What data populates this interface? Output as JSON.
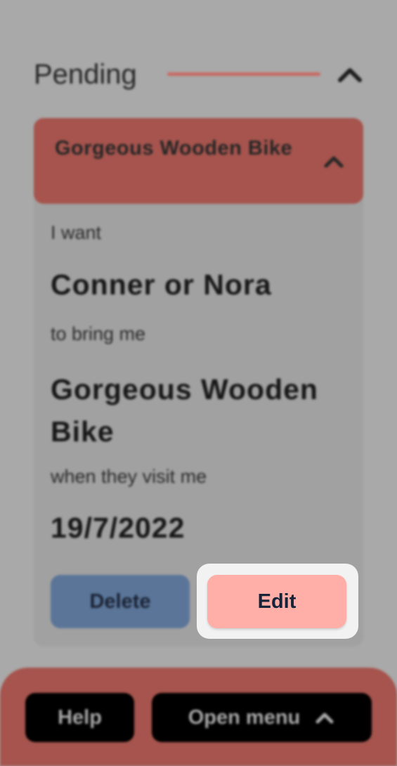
{
  "section": {
    "title": "Pending"
  },
  "request": {
    "title": "Gorgeous Wooden Bike",
    "intro": "I want",
    "people": "Conner or Nora",
    "bring_text": "to bring me",
    "item": "Gorgeous Wooden Bike",
    "visit_text": "when they visit me",
    "date": "19/7/2022",
    "delete_label": "Delete",
    "edit_label": "Edit"
  },
  "footer": {
    "help_label": "Help",
    "menu_label": "Open menu"
  },
  "icons": {
    "section_toggle": "chevron-up-icon",
    "card_toggle": "chevron-up-icon",
    "menu_toggle": "chevron-up-icon"
  },
  "colors": {
    "overlay_bg": "#a9a9a9",
    "accent": "#a6544d",
    "edit_button": "#ffaea8",
    "delete_button": "#5a7598",
    "footer_button": "#000000"
  }
}
